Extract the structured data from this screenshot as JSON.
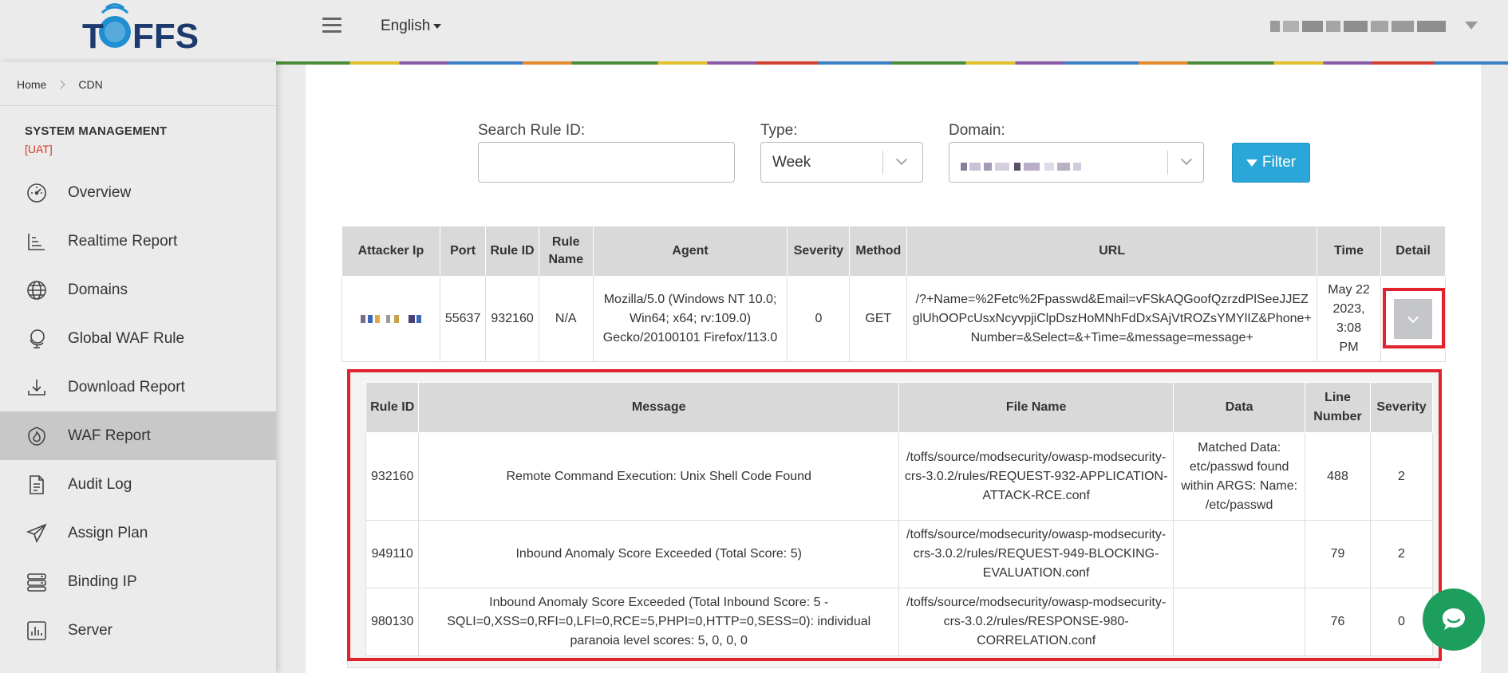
{
  "header": {
    "logo_text": "TOFFS",
    "language": "English"
  },
  "sidebar": {
    "breadcrumb": [
      "Home",
      "CDN"
    ],
    "section_title": "SYSTEM MANAGEMENT",
    "env_tag": "[UAT]",
    "items": [
      {
        "label": "Overview",
        "icon": "gauge-icon"
      },
      {
        "label": "Realtime Report",
        "icon": "bar-chart-icon"
      },
      {
        "label": "Domains",
        "icon": "globe-icon"
      },
      {
        "label": "Global WAF Rule",
        "icon": "globe-stand-icon"
      },
      {
        "label": "Download Report",
        "icon": "download-icon"
      },
      {
        "label": "WAF Report",
        "icon": "shield-flame-icon",
        "active": true
      },
      {
        "label": "Audit Log",
        "icon": "document-icon"
      },
      {
        "label": "Assign Plan",
        "icon": "paper-plane-icon"
      },
      {
        "label": "Binding IP",
        "icon": "server-stack-icon"
      },
      {
        "label": "Server",
        "icon": "chart-box-icon"
      }
    ]
  },
  "filters": {
    "search_label": "Search Rule ID:",
    "search_value": "",
    "type_label": "Type:",
    "type_value": "Week",
    "domain_label": "Domain:",
    "filter_button": "Filter"
  },
  "main_table": {
    "headers": [
      "Attacker Ip",
      "Port",
      "Rule ID",
      "Rule Name",
      "Agent",
      "Severity",
      "Method",
      "URL",
      "Time",
      "Detail"
    ],
    "rows": [
      {
        "port": "55637",
        "rule_id": "932160",
        "rule_name": "N/A",
        "agent": "Mozilla/5.0 (Windows NT 10.0; Win64; x64; rv:109.0) Gecko/20100101 Firefox/113.0",
        "severity": "0",
        "method": "GET",
        "url": "/?+Name=%2Fetc%2Fpasswd&Email=vFSkAQGoofQzrzdPlSeeJJEZglUhOOPcUsxNcyvpjiClpDszHoMNhFdDxSAjVtROZsYMYlIZ&Phone+Number=&Select=&+Time=&message=message+",
        "time": "May 22 2023, 3:08 PM"
      }
    ]
  },
  "detail_table": {
    "headers": [
      "Rule ID",
      "Message",
      "File Name",
      "Data",
      "Line Number",
      "Severity"
    ],
    "rows": [
      {
        "rule_id": "932160",
        "message": "Remote Command Execution: Unix Shell Code Found",
        "file_name": "/toffs/source/modsecurity/owasp-modsecurity-crs-3.0.2/rules/REQUEST-932-APPLICATION-ATTACK-RCE.conf",
        "data": "Matched Data: etc/passwd found within ARGS: Name: /etc/passwd",
        "line_number": "488",
        "severity": "2"
      },
      {
        "rule_id": "949110",
        "message": "Inbound Anomaly Score Exceeded (Total Score: 5)",
        "file_name": "/toffs/source/modsecurity/owasp-modsecurity-crs-3.0.2/rules/REQUEST-949-BLOCKING-EVALUATION.conf",
        "data": "",
        "line_number": "79",
        "severity": "2"
      },
      {
        "rule_id": "980130",
        "message": "Inbound Anomaly Score Exceeded (Total Inbound Score: 5 - SQLI=0,XSS=0,RFI=0,LFI=0,RCE=5,PHPI=0,HTTP=0,SESS=0): individual paranoia level scores: 5, 0, 0, 0",
        "file_name": "/toffs/source/modsecurity/owasp-modsecurity-crs-3.0.2/rules/RESPONSE-980-CORRELATION.conf",
        "data": "",
        "line_number": "76",
        "severity": "0"
      }
    ]
  },
  "colors": {
    "accent": "#2aa6d8",
    "highlight": "#e0232c",
    "chat": "#1e9e5c",
    "env_tag": "#d23b2a"
  }
}
